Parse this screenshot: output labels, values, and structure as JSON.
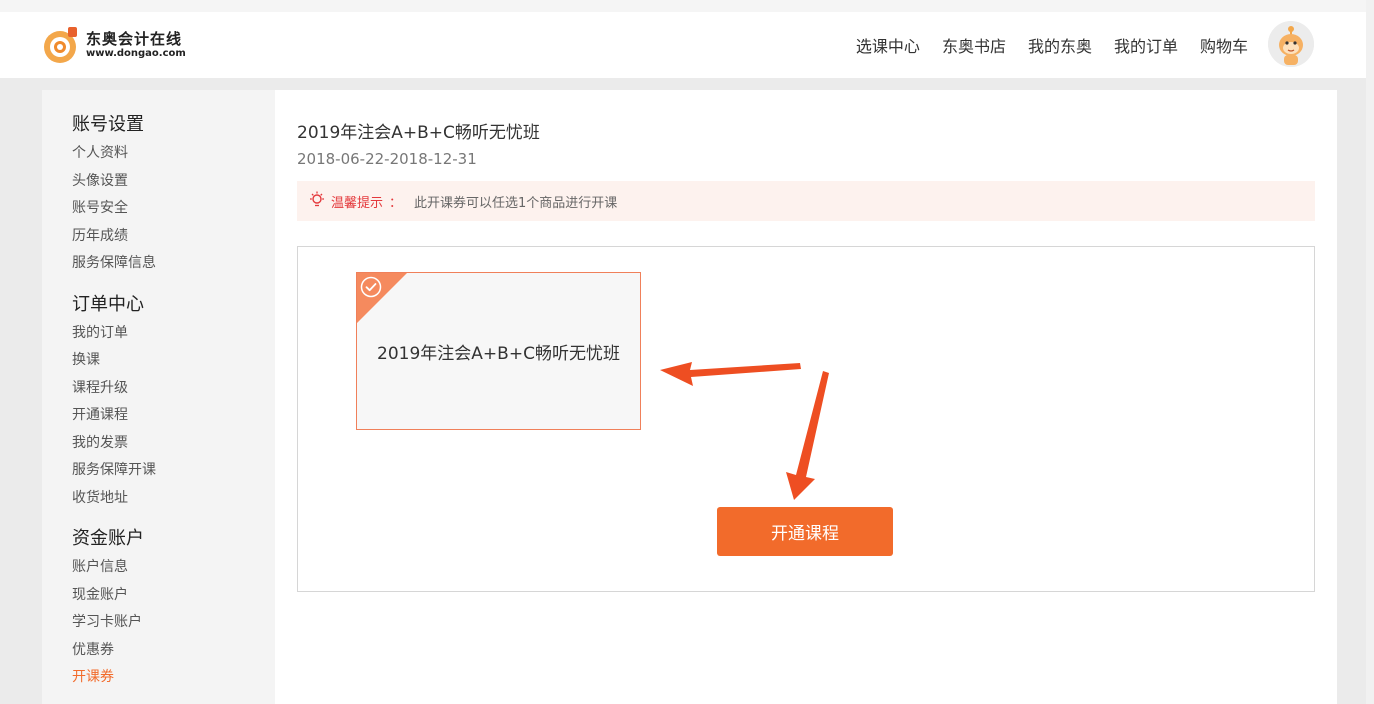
{
  "header": {
    "logo_cn": "东奥会计在线",
    "logo_url": "www.dongao.com",
    "nav": [
      "选课中心",
      "东奥书店",
      "我的东奥",
      "我的订单",
      "购物车"
    ]
  },
  "sidebar": {
    "groups": [
      {
        "title": "账号设置",
        "items": [
          "个人资料",
          "头像设置",
          "账号安全",
          "历年成绩",
          "服务保障信息"
        ]
      },
      {
        "title": "订单中心",
        "items": [
          "我的订单",
          "换课",
          "课程升级",
          "开通课程",
          "我的发票",
          "服务保障开课",
          "收货地址"
        ]
      },
      {
        "title": "资金账户",
        "items": [
          "账户信息",
          "现金账户",
          "学习卡账户",
          "优惠券",
          "开课券"
        ]
      }
    ],
    "active_item": "开课券"
  },
  "main": {
    "title": "2019年注会A+B+C畅听无忧班",
    "date_range": "2018-06-22-2018-12-31",
    "tip": {
      "icon": "lightbulb-icon",
      "label": "温馨提示",
      "colon": "：",
      "text": "此开课券可以任选1个商品进行开课"
    },
    "card": {
      "name": "2019年注会A+B+C畅听无忧班",
      "selected": true
    },
    "open_button": "开通课程"
  },
  "colors": {
    "accent": "#f26b2b",
    "tip_bg": "#fdf2ee",
    "tip_label": "#e4393c",
    "arrow": "#ee4e22"
  }
}
